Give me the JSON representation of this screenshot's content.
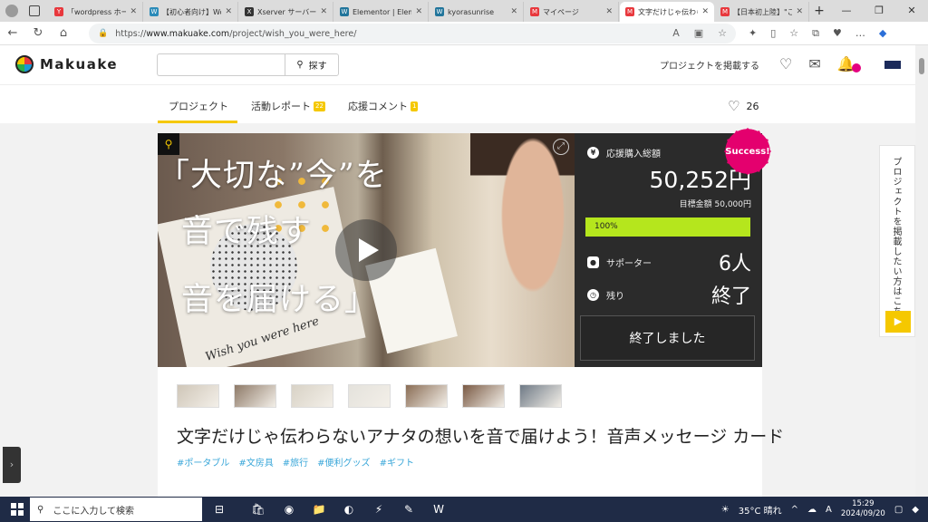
{
  "browser": {
    "tabs": [
      {
        "title": "「wordpress ホーム…",
        "fav_color": "#e8383d",
        "fav_glyph": "Y",
        "active": false
      },
      {
        "title": "【初心者向け】Wor…",
        "fav_color": "#2a8ab8",
        "fav_glyph": "W",
        "active": false
      },
      {
        "title": "Xserver サーバーパネル",
        "fav_color": "#333333",
        "fav_glyph": "X",
        "active": false
      },
      {
        "title": "Elementor | Elementor",
        "fav_color": "#21759b",
        "fav_glyph": "W",
        "active": false
      },
      {
        "title": "kyorasunrise",
        "fav_color": "#21759b",
        "fav_glyph": "W",
        "active": false
      },
      {
        "title": "マイページ",
        "fav_color": "#e8383d",
        "fav_glyph": "M",
        "active": false
      },
      {
        "title": "文字だけじゃ伝わら…",
        "fav_color": "#e8383d",
        "fav_glyph": "M",
        "active": true
      },
      {
        "title": "【日本初上陸】\"こだ…",
        "fav_color": "#e8383d",
        "fav_glyph": "M",
        "active": false
      }
    ],
    "url_prefix": "https://",
    "url_host": "www.makuake.com",
    "url_path": "/project/wish_you_were_here/"
  },
  "header": {
    "logo_text": "Makuake",
    "search_placeholder": "",
    "search_button": "探す",
    "post_project_link": "プロジェクトを掲載する"
  },
  "project_tabs": {
    "items": [
      {
        "label": "プロジェクト",
        "badge": ""
      },
      {
        "label": "活動レポート",
        "badge": "22"
      },
      {
        "label": "応援コメント",
        "badge": "1"
      }
    ],
    "favorite_count": "26"
  },
  "hero": {
    "lines": [
      "「大切な”今”を",
      "音で残す",
      "音を届ける」"
    ],
    "handwriting": "Wish you were here"
  },
  "stats": {
    "total_label": "応援購入総額",
    "total_amount": "50,252円",
    "target": "目標金額 50,000円",
    "progress_text": "100%",
    "progress_fraction": 1.0,
    "supporters_label": "サポーター",
    "supporters_value": "6人",
    "remaining_label": "残り",
    "remaining_value": "終了",
    "ended_button": "終了しました",
    "success_badge": "Success!",
    "accent_color": "#b5e61d"
  },
  "project": {
    "title": "文字だけじゃ伝わらないアナタの想いを音で届けよう！音声メッセージ カード",
    "tags": [
      "#ポータブル",
      "#文房具",
      "#旅行",
      "#便利グッズ",
      "#ギフト"
    ],
    "thumbnail_count": 7
  },
  "side_cta": {
    "text": "プロジェクトを掲載したい方はこちら"
  },
  "taskbar": {
    "search_placeholder": "ここに入力して検索",
    "weather": "35°C 晴れ",
    "ime": "A",
    "time": "15:29",
    "date": "2024/09/20"
  }
}
